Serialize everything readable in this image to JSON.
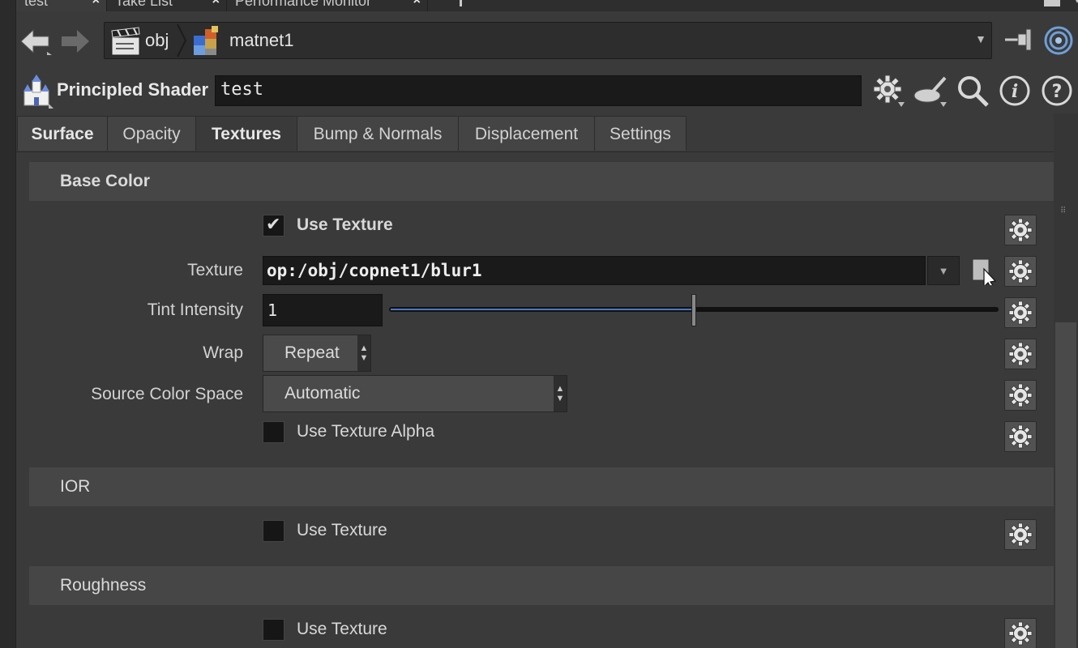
{
  "window_tabs": [
    {
      "label": "test"
    },
    {
      "label": "Take List"
    },
    {
      "label": "Performance Monitor"
    }
  ],
  "nav": {
    "path": [
      {
        "label": "obj",
        "icon": "clapboard-icon"
      },
      {
        "label": "matnet1",
        "icon": "material-network-icon"
      }
    ]
  },
  "header": {
    "node_type": "Principled Shader",
    "node_name": "test"
  },
  "param_tabs": [
    {
      "label": "Surface"
    },
    {
      "label": "Opacity"
    },
    {
      "label": "Textures"
    },
    {
      "label": "Bump & Normals"
    },
    {
      "label": "Displacement"
    },
    {
      "label": "Settings"
    }
  ],
  "sections": {
    "base_color": {
      "title": "Base Color",
      "use_texture_label": "Use Texture",
      "use_texture_checked": true,
      "texture_label": "Texture",
      "texture_value": "op:/obj/copnet1/blur1",
      "tint_label": "Tint Intensity",
      "tint_value": "1",
      "tint_fraction": 0.5,
      "wrap_label": "Wrap",
      "wrap_value": "Repeat",
      "colorspace_label": "Source Color Space",
      "colorspace_value": "Automatic",
      "alpha_label": "Use Texture Alpha",
      "alpha_checked": false
    },
    "ior": {
      "title": "IOR",
      "use_texture_label": "Use Texture",
      "use_texture_checked": false
    },
    "roughness": {
      "title": "Roughness",
      "use_texture_label": "Use Texture",
      "use_texture_checked": false
    }
  }
}
